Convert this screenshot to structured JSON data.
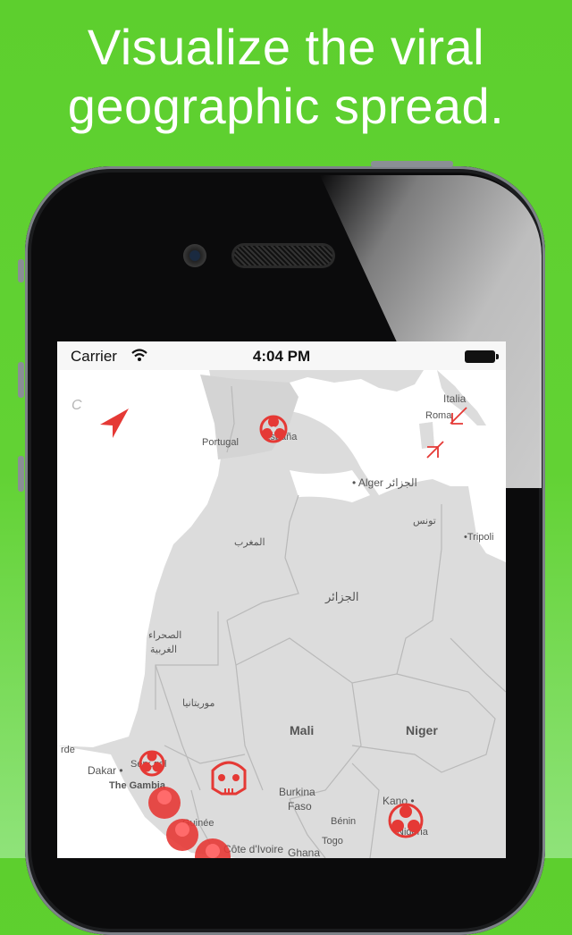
{
  "headline": {
    "line1": "Visualize the viral",
    "line2": "geographic spread."
  },
  "status_bar": {
    "carrier": "Carrier",
    "time": "4:04 PM"
  },
  "map": {
    "labels": {
      "italia": "Italia",
      "roma": "Roma",
      "portugal": "Portugal",
      "espana": "España",
      "alger": "• Alger الجزائر",
      "tunis": "تونس",
      "tripoli": "•Tripoli",
      "morocco": "المغرب",
      "algeria": "الجزائر",
      "w_sahara_1": "الصحراء",
      "w_sahara_2": "الغربية",
      "mauritania": "موريتانيا",
      "mali": "Mali",
      "niger": "Niger",
      "dakar": "Dakar •",
      "senegal": "Sénégal",
      "gambia": "The Gambia",
      "cap_verde": "rde",
      "burkina_1": "Burkina",
      "burkina_2": "Faso",
      "kano": "Kano •",
      "guinee": "Guinée",
      "cote_ivoire": "Côte d'Ivoire",
      "benin": "Bénin",
      "togo": "Togo",
      "ghana": "Ghana",
      "nigeria": "Nigeria"
    },
    "compass_letter": "C"
  },
  "colors": {
    "background": "#5dcf2e",
    "marker": "#e53935",
    "map_land": "#dcdcdc",
    "map_sea": "#ffffff"
  }
}
